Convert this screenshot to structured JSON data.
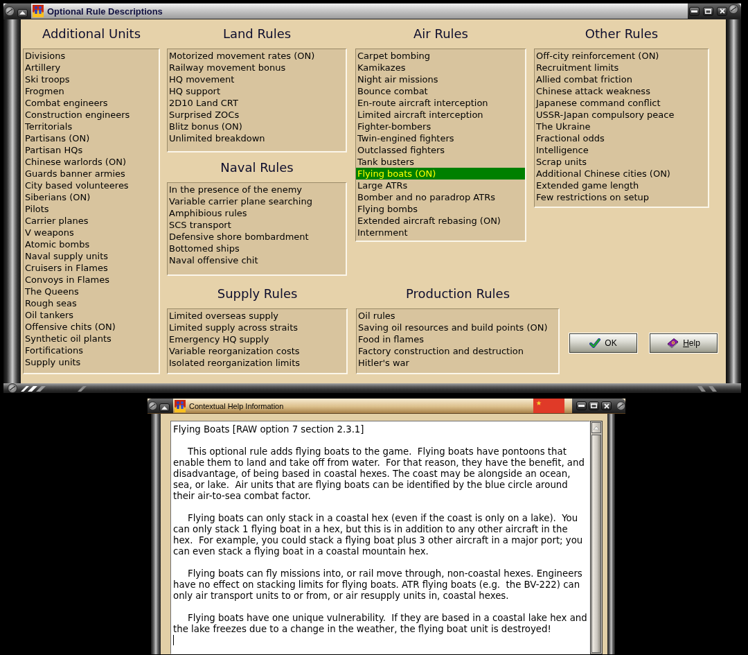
{
  "window": {
    "title": "Optional Rule Descriptions"
  },
  "rule_lists": {
    "additional_units": {
      "heading": "Additional Units",
      "items": [
        {
          "label": "Divisions",
          "selected": false
        },
        {
          "label": "Artillery",
          "selected": false
        },
        {
          "label": "Ski troops",
          "selected": false
        },
        {
          "label": "Frogmen",
          "selected": false
        },
        {
          "label": "Combat engineers",
          "selected": false
        },
        {
          "label": "Construction engineers",
          "selected": false
        },
        {
          "label": "Territorials",
          "selected": false
        },
        {
          "label": "Partisans (ON)",
          "selected": false
        },
        {
          "label": "Partisan HQs",
          "selected": false
        },
        {
          "label": "Chinese warlords (ON)",
          "selected": false
        },
        {
          "label": "Guards banner armies",
          "selected": false
        },
        {
          "label": "City based volunteeres",
          "selected": false
        },
        {
          "label": "Siberians (ON)",
          "selected": false
        },
        {
          "label": "Pilots",
          "selected": false
        },
        {
          "label": "Carrier planes",
          "selected": false
        },
        {
          "label": "V weapons",
          "selected": false
        },
        {
          "label": "Atomic bombs",
          "selected": false
        },
        {
          "label": "Naval supply units",
          "selected": false
        },
        {
          "label": "Cruisers in Flames",
          "selected": false
        },
        {
          "label": "Convoys in Flames",
          "selected": false
        },
        {
          "label": "The Queens",
          "selected": false
        },
        {
          "label": "Rough seas",
          "selected": false
        },
        {
          "label": "Oil tankers",
          "selected": false
        },
        {
          "label": "Offensive chits (ON)",
          "selected": false
        },
        {
          "label": "Synthetic oil plants",
          "selected": false
        },
        {
          "label": "Fortifications",
          "selected": false
        },
        {
          "label": "Supply units",
          "selected": false
        }
      ]
    },
    "land_rules": {
      "heading": "Land Rules",
      "items": [
        {
          "label": "Motorized movement rates (ON)",
          "selected": false
        },
        {
          "label": "Railway movement bonus",
          "selected": false
        },
        {
          "label": "HQ movement",
          "selected": false
        },
        {
          "label": "HQ support",
          "selected": false
        },
        {
          "label": "2D10 Land CRT",
          "selected": false
        },
        {
          "label": "Surprised ZOCs",
          "selected": false
        },
        {
          "label": "Blitz bonus (ON)",
          "selected": false
        },
        {
          "label": "Unlimited breakdown",
          "selected": false
        }
      ]
    },
    "naval_rules": {
      "heading": "Naval Rules",
      "items": [
        {
          "label": "In the presence of the enemy",
          "selected": false
        },
        {
          "label": "Variable carrier plane searching",
          "selected": false
        },
        {
          "label": "Amphibious rules",
          "selected": false
        },
        {
          "label": "SCS transport",
          "selected": false
        },
        {
          "label": "Defensive shore bombardment",
          "selected": false
        },
        {
          "label": "Bottomed ships",
          "selected": false
        },
        {
          "label": "Naval offensive chit",
          "selected": false
        }
      ]
    },
    "air_rules": {
      "heading": "Air Rules",
      "items": [
        {
          "label": "Carpet bombing",
          "selected": false
        },
        {
          "label": "Kamikazes",
          "selected": false
        },
        {
          "label": "Night air missions",
          "selected": false
        },
        {
          "label": "Bounce combat",
          "selected": false
        },
        {
          "label": "En-route aircraft interception",
          "selected": false
        },
        {
          "label": "Limited aircraft interception",
          "selected": false
        },
        {
          "label": "Fighter-bombers",
          "selected": false
        },
        {
          "label": "Twin-engined fighters",
          "selected": false
        },
        {
          "label": "Outclassed fighters",
          "selected": false
        },
        {
          "label": "Tank busters",
          "selected": false
        },
        {
          "label": "Flying boats (ON)",
          "selected": true
        },
        {
          "label": "Large ATRs",
          "selected": false
        },
        {
          "label": "Bomber and no paradrop ATRs",
          "selected": false
        },
        {
          "label": "Flying bombs",
          "selected": false
        },
        {
          "label": "Extended aircraft rebasing (ON)",
          "selected": false
        },
        {
          "label": "Internment",
          "selected": false
        }
      ]
    },
    "other_rules": {
      "heading": "Other Rules",
      "items": [
        {
          "label": "Off-city reinforcement (ON)",
          "selected": false
        },
        {
          "label": "Recruitment limits",
          "selected": false
        },
        {
          "label": "Allied combat friction",
          "selected": false
        },
        {
          "label": "Chinese attack weakness",
          "selected": false
        },
        {
          "label": "Japanese command conflict",
          "selected": false
        },
        {
          "label": "USSR-Japan compulsory peace",
          "selected": false
        },
        {
          "label": "The Ukraine",
          "selected": false
        },
        {
          "label": "Fractional odds",
          "selected": false
        },
        {
          "label": "Intelligence",
          "selected": false
        },
        {
          "label": "Scrap units",
          "selected": false
        },
        {
          "label": "Additional Chinese cities (ON)",
          "selected": false
        },
        {
          "label": "Extended game length",
          "selected": false
        },
        {
          "label": "Few restrictions on setup",
          "selected": false
        }
      ]
    },
    "supply_rules": {
      "heading": "Supply Rules",
      "items": [
        {
          "label": "Limited overseas supply",
          "selected": false
        },
        {
          "label": "Limited supply across straits",
          "selected": false
        },
        {
          "label": "Emergency HQ supply",
          "selected": false
        },
        {
          "label": "Variable reorganization costs",
          "selected": false
        },
        {
          "label": "Isolated reorganization limits",
          "selected": false
        }
      ]
    },
    "production_rules": {
      "heading": "Production Rules",
      "items": [
        {
          "label": "Oil rules",
          "selected": false
        },
        {
          "label": "Saving oil resources and build points (ON)",
          "selected": false
        },
        {
          "label": "Food in flames",
          "selected": false
        },
        {
          "label": "Factory construction and destruction",
          "selected": false
        },
        {
          "label": "Hitler's war",
          "selected": false
        }
      ]
    }
  },
  "buttons": [
    {
      "label": "OK",
      "kind": "confirm",
      "shortcut_underlined": false
    },
    {
      "label": "Help",
      "kind": "help",
      "shortcut_underlined": true
    }
  ],
  "help_window": {
    "title": "Contextual Help Information",
    "heading": "Flying Boats [RAW option 7 section 2.3.1]",
    "paragraphs": [
      "This optional rule adds flying boats to the game.  Flying boats have pontoons that enable them to land and take off from water.  For that reason, they have the benefit, and disadvantage, of being based in coastal hexes. The coast may be alongside an ocean, sea, or lake.  Air units that are flying boats can be identified by the blue circle around their air-to-sea combat factor.",
      "Flying boats can only stack in a coastal hex (even if the coast is only on a lake).  You can only stack 1 flying boat in a hex, but this is in addition to any other aircraft in the hex.  For example, you could stack a flying boat plus 3 other aircraft in a major port; you can even stack a flying boat in a coastal mountain hex.",
      "Flying boats can fly missions into, or rail move through, non-coastal hexes. Engineers have no effect on stacking limits for flying boats. ATR flying boats (e.g.  the BV-222) can only air transport units to or from, or air resupply units in, coastal hexes.",
      "Flying boats have one unique vulnerability.  If they are based in a coastal lake hex and the lake freezes due to a change in the weather, the flying boat unit is destroyed!"
    ]
  }
}
